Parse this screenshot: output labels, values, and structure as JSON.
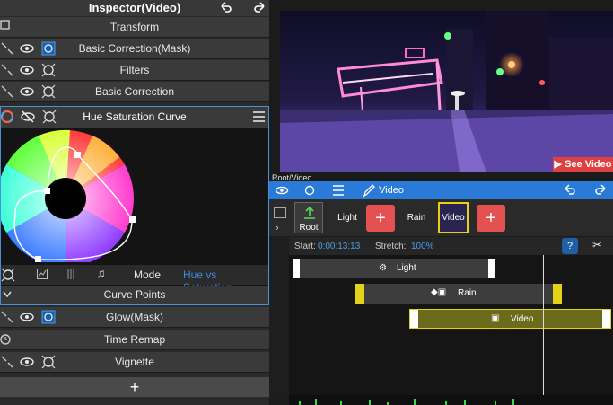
{
  "inspector": {
    "title": "Inspector(Video)",
    "rows": {
      "transform": "Transform",
      "basic_correction_mask": "Basic Correction(Mask)",
      "filters": "Filters",
      "basic_correction": "Basic Correction",
      "glow_mask": "Glow(Mask)",
      "time_remap": "Time Remap",
      "vignette": "Vignette"
    },
    "hsc": {
      "title": "Hue Saturation Curve",
      "mode_label": "Mode",
      "mode_value": "Hue vs Saturation",
      "curve_points": "Curve Points"
    },
    "add_label": "+"
  },
  "preview": {
    "see_video": "See Video"
  },
  "breadcrumb": "Root/Video",
  "timeline_toolbar": {
    "video_label": "Video"
  },
  "track_strip": {
    "root": "Root",
    "light": "Light",
    "rain": "Rain",
    "video": "Video",
    "plus": "+"
  },
  "info": {
    "start_label": "Start:",
    "start_value": "0:00:13:13",
    "stretch_label": "Stretch:",
    "stretch_value": "100%"
  },
  "tracks": {
    "light": "Light",
    "rain": "Rain",
    "video": "Video"
  },
  "colors": {
    "accent_blue": "#2a7ad8",
    "highlight_blue": "#3e8ce0",
    "red_button": "#e45151",
    "video_track": "#6b6b1c",
    "keyframe_yellow": "#e3d11a"
  }
}
